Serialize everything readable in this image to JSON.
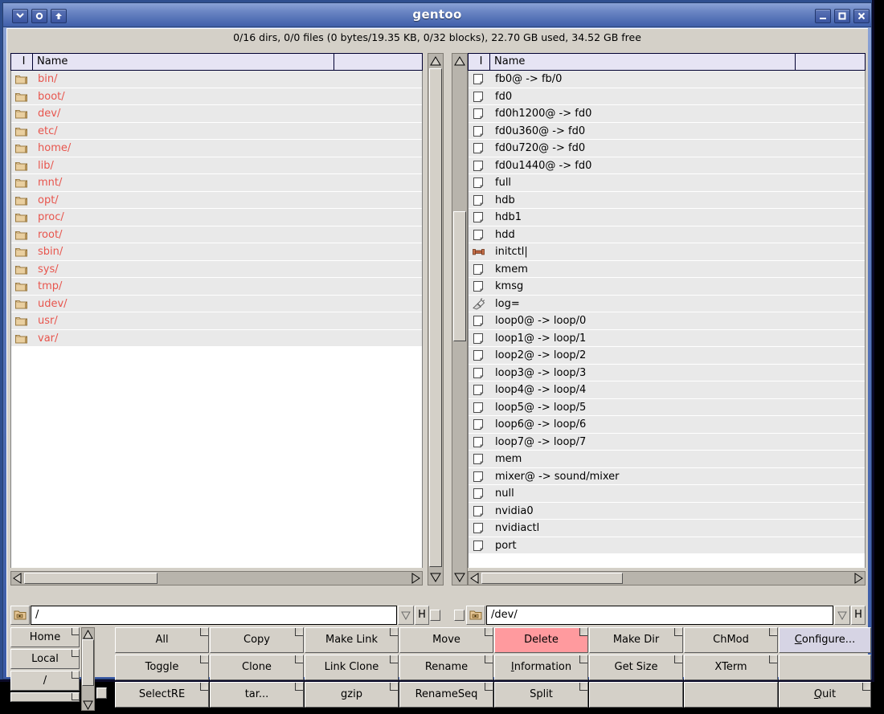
{
  "window": {
    "title": "gentoo",
    "titlebar_buttons": [
      {
        "name": "shade-window-button",
        "glyph": "chevron-down-icon"
      },
      {
        "name": "iconify-window-button",
        "glyph": "circle-icon"
      },
      {
        "name": "raise-window-button",
        "glyph": "arrow-up-icon"
      }
    ],
    "controls": [
      {
        "name": "minimize-window-button",
        "glyph": "minimize-icon"
      },
      {
        "name": "maximize-window-button",
        "glyph": "maximize-icon"
      },
      {
        "name": "close-window-button",
        "glyph": "close-icon"
      }
    ]
  },
  "status": {
    "line": "0/16 dirs, 0/0 files (0 bytes/19.35 KB, 0/32 blocks), 22.70 GB used, 34.52 GB free"
  },
  "columns": {
    "flag": "I",
    "name": "Name"
  },
  "left_panel": {
    "path": "/",
    "history_button": "H",
    "items": [
      {
        "icon": "folder-icon",
        "name": "bin/",
        "kind": "dir"
      },
      {
        "icon": "folder-icon",
        "name": "boot/",
        "kind": "dir"
      },
      {
        "icon": "folder-icon",
        "name": "dev/",
        "kind": "dir"
      },
      {
        "icon": "folder-icon",
        "name": "etc/",
        "kind": "dir"
      },
      {
        "icon": "folder-icon",
        "name": "home/",
        "kind": "dir"
      },
      {
        "icon": "folder-icon",
        "name": "lib/",
        "kind": "dir"
      },
      {
        "icon": "folder-icon",
        "name": "mnt/",
        "kind": "dir"
      },
      {
        "icon": "folder-icon",
        "name": "opt/",
        "kind": "dir"
      },
      {
        "icon": "folder-icon",
        "name": "proc/",
        "kind": "dir"
      },
      {
        "icon": "folder-icon",
        "name": "root/",
        "kind": "dir"
      },
      {
        "icon": "folder-icon",
        "name": "sbin/",
        "kind": "dir"
      },
      {
        "icon": "folder-icon",
        "name": "sys/",
        "kind": "dir"
      },
      {
        "icon": "folder-icon",
        "name": "tmp/",
        "kind": "dir"
      },
      {
        "icon": "folder-icon",
        "name": "udev/",
        "kind": "dir"
      },
      {
        "icon": "folder-icon",
        "name": "usr/",
        "kind": "dir"
      },
      {
        "icon": "folder-icon",
        "name": "var/",
        "kind": "dir"
      }
    ]
  },
  "right_panel": {
    "path": "/dev/",
    "history_button": "H",
    "items": [
      {
        "icon": "file-icon",
        "name": "fb0@ -> fb/0",
        "kind": "file"
      },
      {
        "icon": "file-icon",
        "name": "fd0",
        "kind": "file"
      },
      {
        "icon": "file-icon",
        "name": "fd0h1200@ -> fd0",
        "kind": "file"
      },
      {
        "icon": "file-icon",
        "name": "fd0u360@ -> fd0",
        "kind": "file"
      },
      {
        "icon": "file-icon",
        "name": "fd0u720@ -> fd0",
        "kind": "file"
      },
      {
        "icon": "file-icon",
        "name": "fd0u1440@ -> fd0",
        "kind": "file"
      },
      {
        "icon": "file-icon",
        "name": "full",
        "kind": "file"
      },
      {
        "icon": "file-icon",
        "name": "hdb",
        "kind": "file"
      },
      {
        "icon": "file-icon",
        "name": "hdb1",
        "kind": "file"
      },
      {
        "icon": "file-icon",
        "name": "hdd",
        "kind": "file"
      },
      {
        "icon": "pipe-icon",
        "name": "initctl|",
        "kind": "pipe"
      },
      {
        "icon": "file-icon",
        "name": "kmem",
        "kind": "file"
      },
      {
        "icon": "file-icon",
        "name": "kmsg",
        "kind": "file"
      },
      {
        "icon": "socket-icon",
        "name": "log=",
        "kind": "socket"
      },
      {
        "icon": "file-icon",
        "name": "loop0@ -> loop/0",
        "kind": "file"
      },
      {
        "icon": "file-icon",
        "name": "loop1@ -> loop/1",
        "kind": "file"
      },
      {
        "icon": "file-icon",
        "name": "loop2@ -> loop/2",
        "kind": "file"
      },
      {
        "icon": "file-icon",
        "name": "loop3@ -> loop/3",
        "kind": "file"
      },
      {
        "icon": "file-icon",
        "name": "loop4@ -> loop/4",
        "kind": "file"
      },
      {
        "icon": "file-icon",
        "name": "loop5@ -> loop/5",
        "kind": "file"
      },
      {
        "icon": "file-icon",
        "name": "loop6@ -> loop/6",
        "kind": "file"
      },
      {
        "icon": "file-icon",
        "name": "loop7@ -> loop/7",
        "kind": "file"
      },
      {
        "icon": "file-icon",
        "name": "mem",
        "kind": "file"
      },
      {
        "icon": "file-icon",
        "name": "mixer@ -> sound/mixer",
        "kind": "file"
      },
      {
        "icon": "file-icon",
        "name": "null",
        "kind": "file"
      },
      {
        "icon": "file-icon",
        "name": "nvidia0",
        "kind": "file"
      },
      {
        "icon": "file-icon",
        "name": "nvidiactl",
        "kind": "file"
      },
      {
        "icon": "file-icon",
        "name": "port",
        "kind": "file"
      }
    ]
  },
  "quick_buttons": [
    {
      "label": "Home",
      "name": "home-button"
    },
    {
      "label": "Local",
      "name": "local-button"
    },
    {
      "label": "/",
      "name": "root-button"
    }
  ],
  "action_buttons": [
    [
      {
        "label": "All",
        "name": "select-all-button",
        "style": "normal"
      },
      {
        "label": "Copy",
        "name": "copy-button",
        "style": "normal"
      },
      {
        "label": "Make Link",
        "name": "make-link-button",
        "style": "normal"
      },
      {
        "label": "Move",
        "name": "move-button",
        "style": "normal"
      },
      {
        "label": "Delete",
        "name": "delete-button",
        "style": "danger"
      },
      {
        "label": "Make Dir",
        "name": "make-dir-button",
        "style": "normal"
      },
      {
        "label": "ChMod",
        "name": "chmod-button",
        "style": "normal"
      },
      {
        "label": "Configure...",
        "name": "configure-button",
        "style": "default",
        "mnemonic": "C"
      }
    ],
    [
      {
        "label": "Toggle",
        "name": "toggle-button",
        "style": "normal"
      },
      {
        "label": "Clone",
        "name": "clone-button",
        "style": "normal"
      },
      {
        "label": "Link Clone",
        "name": "link-clone-button",
        "style": "normal"
      },
      {
        "label": "Rename",
        "name": "rename-button",
        "style": "normal"
      },
      {
        "label": "Information",
        "name": "information-button",
        "style": "normal",
        "mnemonic": "I"
      },
      {
        "label": "Get Size",
        "name": "get-size-button",
        "style": "normal"
      },
      {
        "label": "XTerm",
        "name": "xterm-button",
        "style": "normal"
      },
      {
        "label": "",
        "name": "empty-slot-1",
        "style": "empty"
      }
    ],
    [
      {
        "label": "SelectRE",
        "name": "select-re-button",
        "style": "normal"
      },
      {
        "label": "tar...",
        "name": "tar-button",
        "style": "normal"
      },
      {
        "label": "gzip",
        "name": "gzip-button",
        "style": "normal"
      },
      {
        "label": "RenameSeq",
        "name": "rename-seq-button",
        "style": "normal"
      },
      {
        "label": "Split",
        "name": "split-button",
        "style": "normal"
      },
      {
        "label": "",
        "name": "empty-slot-2",
        "style": "empty"
      },
      {
        "label": "",
        "name": "empty-slot-3",
        "style": "empty"
      },
      {
        "label": "Quit",
        "name": "quit-button",
        "style": "normal",
        "mnemonic": "Q"
      }
    ]
  ],
  "colors": {
    "titlebar": "#3f5faa",
    "face": "#d4d0c8",
    "dir_text": "#e8554d",
    "header_bg": "#e6e4f4",
    "row_bg": "#e9e9e9",
    "danger_bg": "#ff9a9e",
    "default_bg": "#d6d4e4"
  }
}
